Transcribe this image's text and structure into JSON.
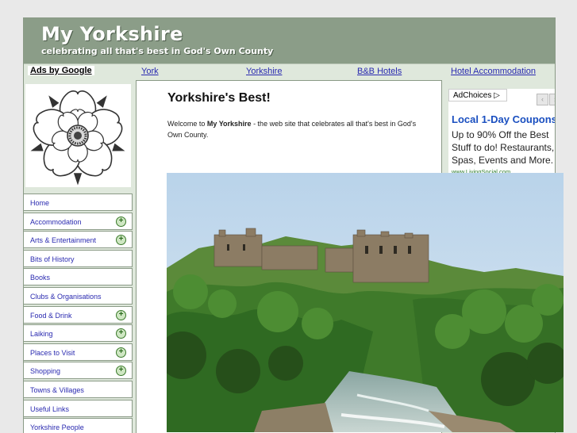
{
  "header": {
    "title": "My Yorkshire",
    "tagline": "celebrating all that's best in God's Own County"
  },
  "adbar": {
    "ads_label": "Ads by Google",
    "links": [
      "York",
      "Yorkshire",
      "B&B Hotels",
      "Hotel Accommodation"
    ]
  },
  "sidebar": {
    "logo_icon": "yorkshire-rose-icon",
    "nav": [
      {
        "label": "Home",
        "expandable": false
      },
      {
        "label": "Accommodation",
        "expandable": true
      },
      {
        "label": "Arts & Entertainment",
        "expandable": true
      },
      {
        "label": "Bits of History",
        "expandable": false
      },
      {
        "label": "Books",
        "expandable": false
      },
      {
        "label": "Clubs & Organisations",
        "expandable": false
      },
      {
        "label": "Food & Drink",
        "expandable": true
      },
      {
        "label": "Laiking",
        "expandable": true
      },
      {
        "label": "Places to Visit",
        "expandable": true
      },
      {
        "label": "Shopping",
        "expandable": true
      },
      {
        "label": "Towns & Villages",
        "expandable": false
      },
      {
        "label": "Useful Links",
        "expandable": false
      },
      {
        "label": "Yorkshire People",
        "expandable": false
      }
    ]
  },
  "main": {
    "title": "Yorkshire's Best!",
    "welcome_prefix": "Welcome to ",
    "welcome_bold": "My Yorkshire",
    "welcome_suffix": " - the web site that celebrates all that's best in God's Own County."
  },
  "ad": {
    "adchoices": "AdChoices",
    "headline": "Local 1-Day Coupons",
    "body": "Up to 90% Off the Best Stuff to do! Restaurants, Spas, Events and More.",
    "url": "www.LivingSocial.com"
  },
  "colors": {
    "header_bg": "#8b9d88",
    "sidebar_bg": "#dfe8dc",
    "link": "#2a2ab0",
    "ad_headline": "#1a4fc0"
  }
}
